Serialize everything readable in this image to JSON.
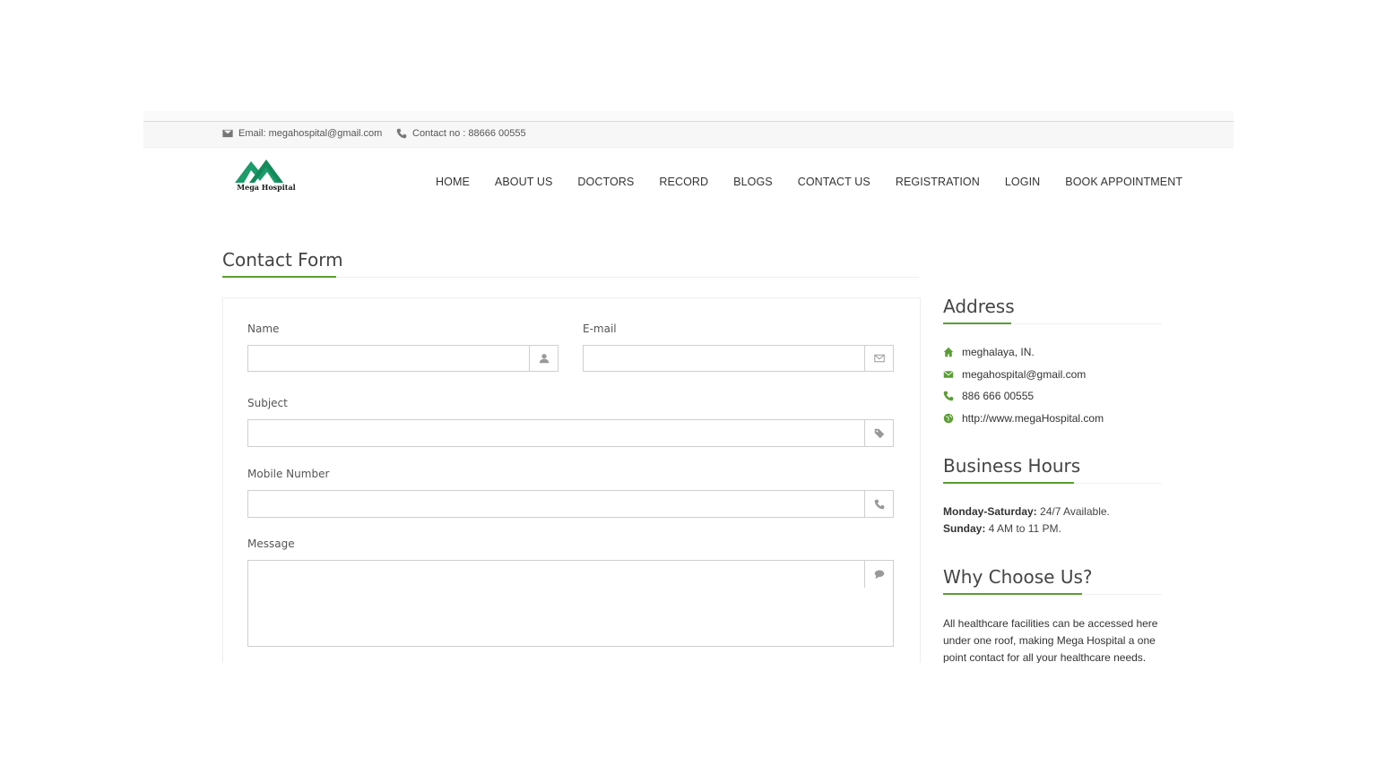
{
  "topbar": {
    "email": "Email: megahospital@gmail.com",
    "contact": "Contact no : 88666 00555"
  },
  "brand": {
    "name": "Mega Hospital",
    "color": "#1b9c6a"
  },
  "nav": {
    "items": [
      "HOME",
      "ABOUT US",
      "DOCTORS",
      "RECORD",
      "BLOGS",
      "CONTACT US",
      "REGISTRATION",
      "LOGIN",
      "BOOK APPOINTMENT"
    ]
  },
  "contact_form": {
    "title": "Contact Form",
    "name_label": "Name",
    "email_label": "E-mail",
    "subject_label": "Subject",
    "mobile_label": "Mobile Number",
    "message_label": "Message",
    "name_value": "",
    "email_value": "",
    "subject_value": "",
    "mobile_value": "",
    "message_value": ""
  },
  "address": {
    "title": "Address",
    "location": "meghalaya, IN.",
    "email": "megahospital@gmail.com",
    "phone": "886 666 00555",
    "website": "http://www.megaHospital.com"
  },
  "business_hours": {
    "title": "Business Hours",
    "weekdays_label": "Monday-Saturday:",
    "weekdays_value": " 24/7 Available.",
    "sunday_label": "Sunday:",
    "sunday_value": " 4 AM to 11 PM."
  },
  "why_choose": {
    "title": "Why Choose Us?",
    "text": "All healthcare facilities can be accessed here under one roof, making Mega Hospital a one point contact for all your healthcare needs."
  },
  "colors": {
    "accent": "#5a9e32",
    "icon_gray": "#999999"
  },
  "icons": {
    "topbar_email": "envelope-icon",
    "topbar_phone": "phone-icon",
    "name": "user-icon",
    "email": "envelope-outline-icon",
    "subject": "tag-icon",
    "mobile": "phone-icon",
    "message": "comment-icon",
    "location": "home-icon",
    "website": "globe-icon"
  }
}
